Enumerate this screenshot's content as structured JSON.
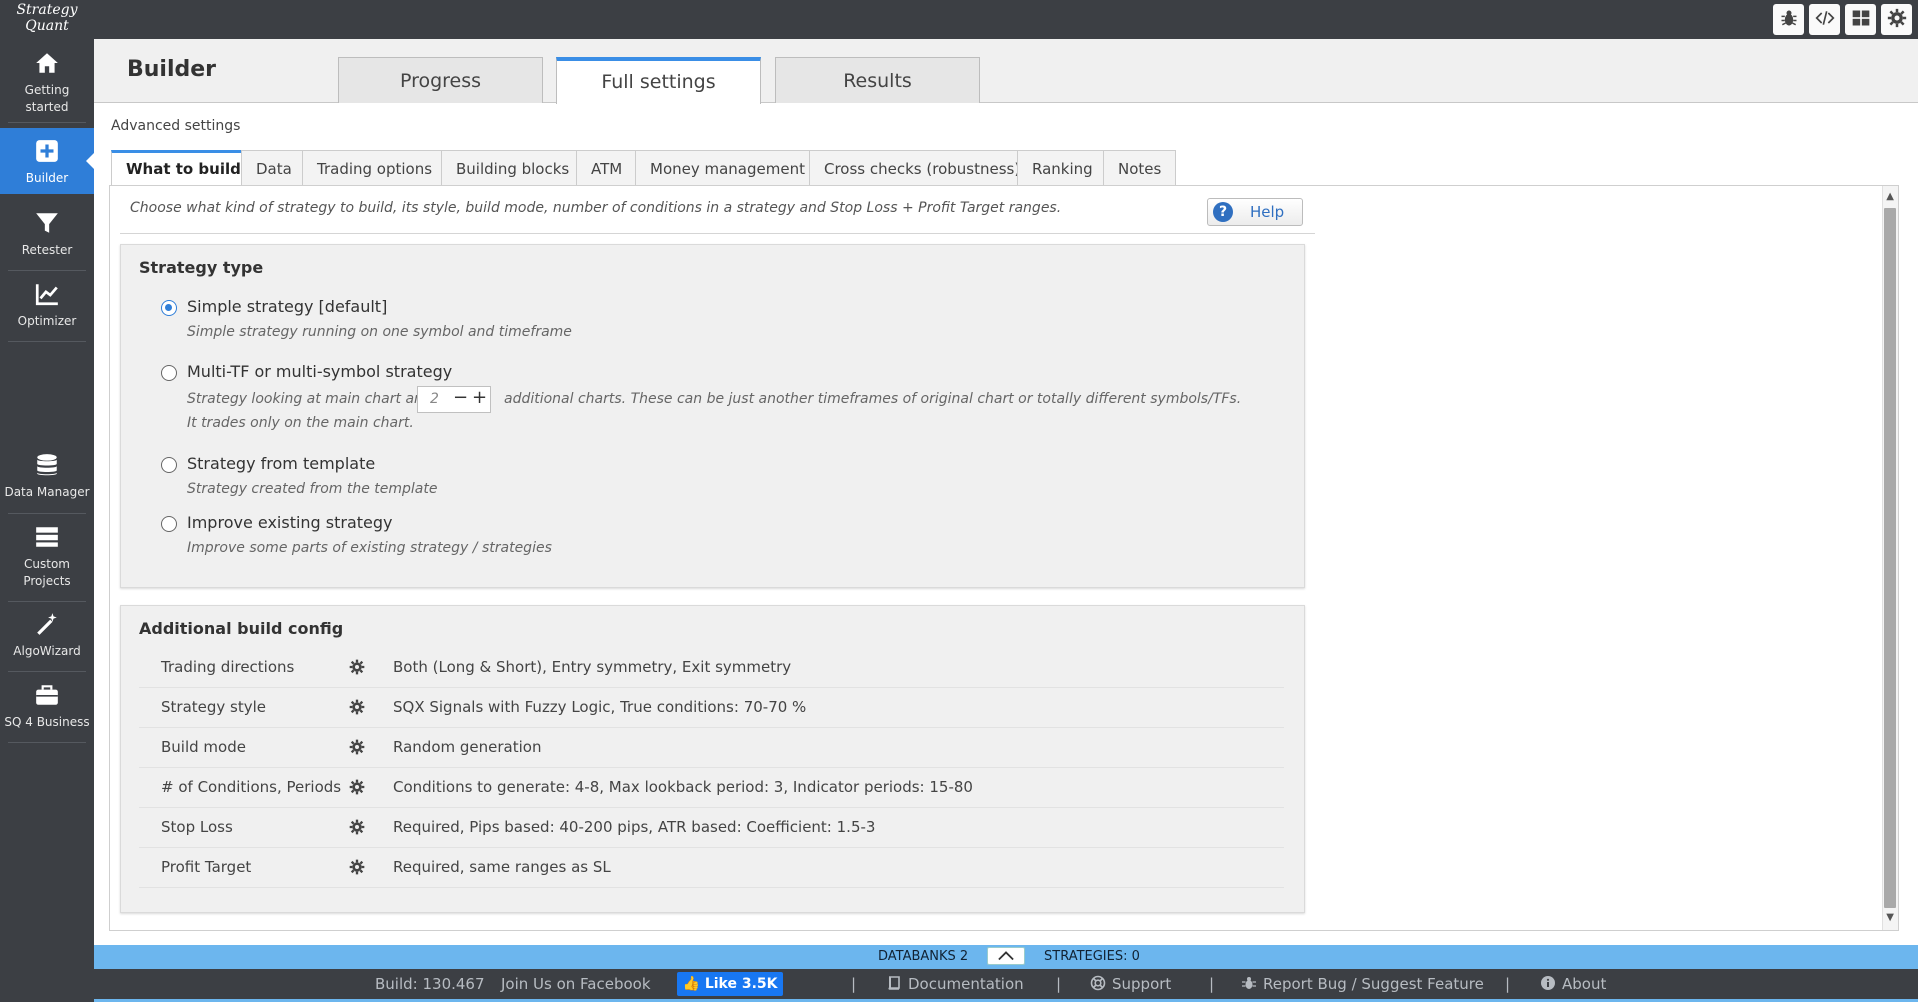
{
  "logo": {
    "line1": "Strategy",
    "line2": "Quant"
  },
  "sidebar": {
    "items": [
      {
        "label": "Getting started",
        "line1": "Getting",
        "line2": "started",
        "icon": "home-icon"
      },
      {
        "label": "Builder",
        "icon": "plus-square-icon",
        "active": true
      },
      {
        "label": "Retester",
        "icon": "filter-icon"
      },
      {
        "label": "Optimizer",
        "icon": "chart-line-icon"
      },
      {
        "label": "Data Manager",
        "icon": "database-icon"
      },
      {
        "label": "Custom Projects",
        "line1": "Custom",
        "line2": "Projects",
        "icon": "server-icon"
      },
      {
        "label": "AlgoWizard",
        "icon": "magic-wand-icon"
      },
      {
        "label": "SQ 4 Business",
        "icon": "briefcase-icon"
      }
    ]
  },
  "topbar": {
    "icons": [
      "bug-icon",
      "code-icon",
      "grid-icon",
      "gear-icon"
    ]
  },
  "header": {
    "title": "Builder",
    "tabs": [
      {
        "label": "Progress",
        "active": false
      },
      {
        "label": "Full settings",
        "active": true
      },
      {
        "label": "Results",
        "active": false
      }
    ]
  },
  "advanced": {
    "label": "Advanced settings",
    "tabs": [
      {
        "label": "What to build",
        "active": true
      },
      {
        "label": "Data"
      },
      {
        "label": "Trading options"
      },
      {
        "label": "Building blocks"
      },
      {
        "label": "ATM"
      },
      {
        "label": "Money management"
      },
      {
        "label": "Cross checks (robustness)"
      },
      {
        "label": "Ranking"
      },
      {
        "label": "Notes"
      }
    ]
  },
  "content": {
    "description": "Choose what kind of strategy to build, its style, build mode, number of conditions in a strategy and Stop Loss + Profit Target ranges.",
    "help_label": "Help",
    "strategy_type": {
      "title": "Strategy type",
      "options": [
        {
          "label": "Simple strategy [default]",
          "sub": "Simple strategy running on one symbol and timeframe",
          "checked": true
        },
        {
          "label": "Multi-TF or multi-symbol strategy",
          "sub_before": "Strategy looking at main chart and",
          "stepper_value": "2",
          "sub_after": "additional charts. These can be just another timeframes of original chart or totally different symbols/TFs.",
          "sub2": "It trades only on the main chart.",
          "checked": false
        },
        {
          "label": "Strategy from template",
          "sub": "Strategy created from the template",
          "checked": false
        },
        {
          "label": "Improve existing strategy",
          "sub": "Improve some parts of existing strategy / strategies",
          "checked": false
        }
      ]
    },
    "additional": {
      "title": "Additional build config",
      "rows": [
        {
          "name": "Trading directions",
          "value": "Both (Long & Short), Entry symmetry, Exit symmetry"
        },
        {
          "name": "Strategy style",
          "value": "SQX Signals with Fuzzy Logic, True conditions: 70-70 %"
        },
        {
          "name": "Build mode",
          "value": "Random generation"
        },
        {
          "name": "# of Conditions, Periods",
          "value": "Conditions to generate: 4-8, Max lookback period: 3, Indicator periods: 15-80"
        },
        {
          "name": "Stop Loss",
          "value": "Required, Pips based: 40-200 pips, ATR based: Coefficient: 1.5-3"
        },
        {
          "name": "Profit Target",
          "value": "Required, same ranges as SL"
        }
      ]
    }
  },
  "status": {
    "databanks": "DATABANKS 2",
    "strategies": "STRATEGIES: 0"
  },
  "footer": {
    "build": "Build: 130.467",
    "join": "Join Us on Facebook",
    "like": "Like 3.5K",
    "separator": "|",
    "documentation": "Documentation",
    "support": "Support",
    "report": "Report Bug / Suggest Feature",
    "about": "About"
  },
  "colors": {
    "accent": "#2f7ed8",
    "sidebar": "#3c3f44",
    "statusbar": "#6cb6ee",
    "facebook": "#1877f2"
  }
}
